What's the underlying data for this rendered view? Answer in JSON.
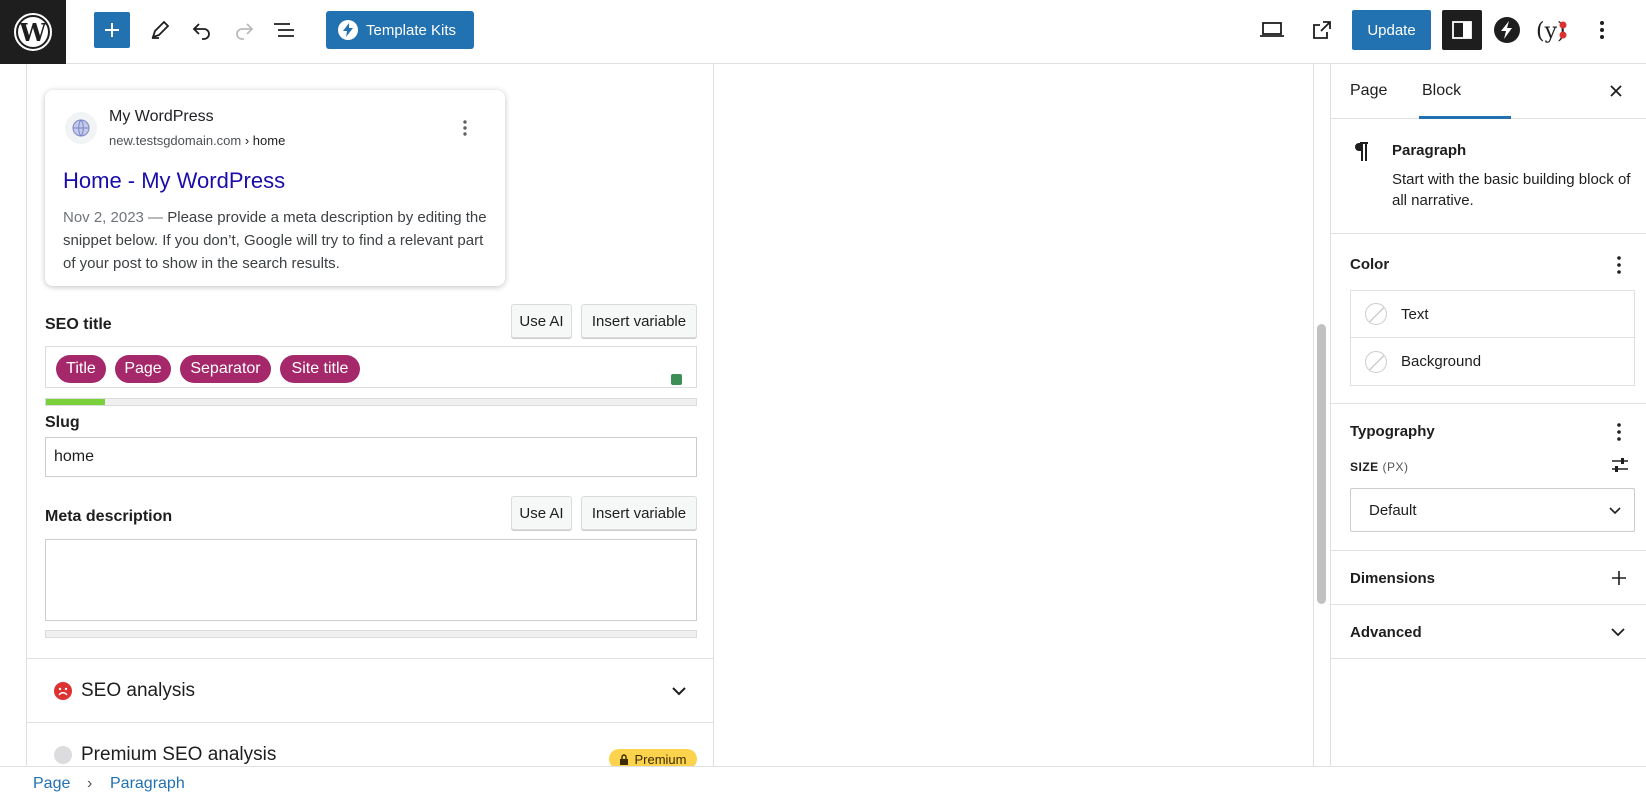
{
  "toolbar": {
    "template_kits_label": "Template Kits",
    "update_label": "Update"
  },
  "snippet": {
    "site_name": "My WordPress",
    "url_domain": "new.testsgdomain.com",
    "url_path": " › home",
    "title": "Home - My WordPress",
    "date": "Nov 2, 2023",
    "separator": " — ",
    "description": "Please provide a meta description by editing the snippet below. If you don’t, Google will try to find a relevant part of your post to show in the search results."
  },
  "seo_title": {
    "label": "SEO title",
    "use_ai": "Use AI",
    "insert_variable": "Insert variable",
    "pills": [
      "Title",
      "Page",
      "Separator",
      "Site title"
    ],
    "progress_fraction": 0.09
  },
  "slug": {
    "label": "Slug",
    "value": "home"
  },
  "meta_description": {
    "label": "Meta description",
    "use_ai": "Use AI",
    "insert_variable": "Insert variable",
    "value": "",
    "progress_fraction": 0
  },
  "sections": {
    "seo_analysis": "SEO analysis",
    "premium_seo_analysis": "Premium SEO analysis",
    "premium_badge": "Premium"
  },
  "sidebar": {
    "tabs": [
      "Page",
      "Block"
    ],
    "active_tab": "Block",
    "block_name": "Paragraph",
    "block_description": "Start with the basic building block of all narrative.",
    "color_heading": "Color",
    "color_items": [
      "Text",
      "Background"
    ],
    "typography_heading": "Typography",
    "size_label": "SIZE",
    "size_unit": "(PX)",
    "size_value": "Default",
    "dimensions_heading": "Dimensions",
    "advanced_heading": "Advanced"
  },
  "breadcrumb": {
    "items": [
      "Page",
      "Paragraph"
    ],
    "separator": "›"
  },
  "colors": {
    "accent": "#2271b1",
    "pill": "#a4286a",
    "progress_good": "#7ad03a",
    "premium": "#fcd34d",
    "error": "#dc3232"
  }
}
